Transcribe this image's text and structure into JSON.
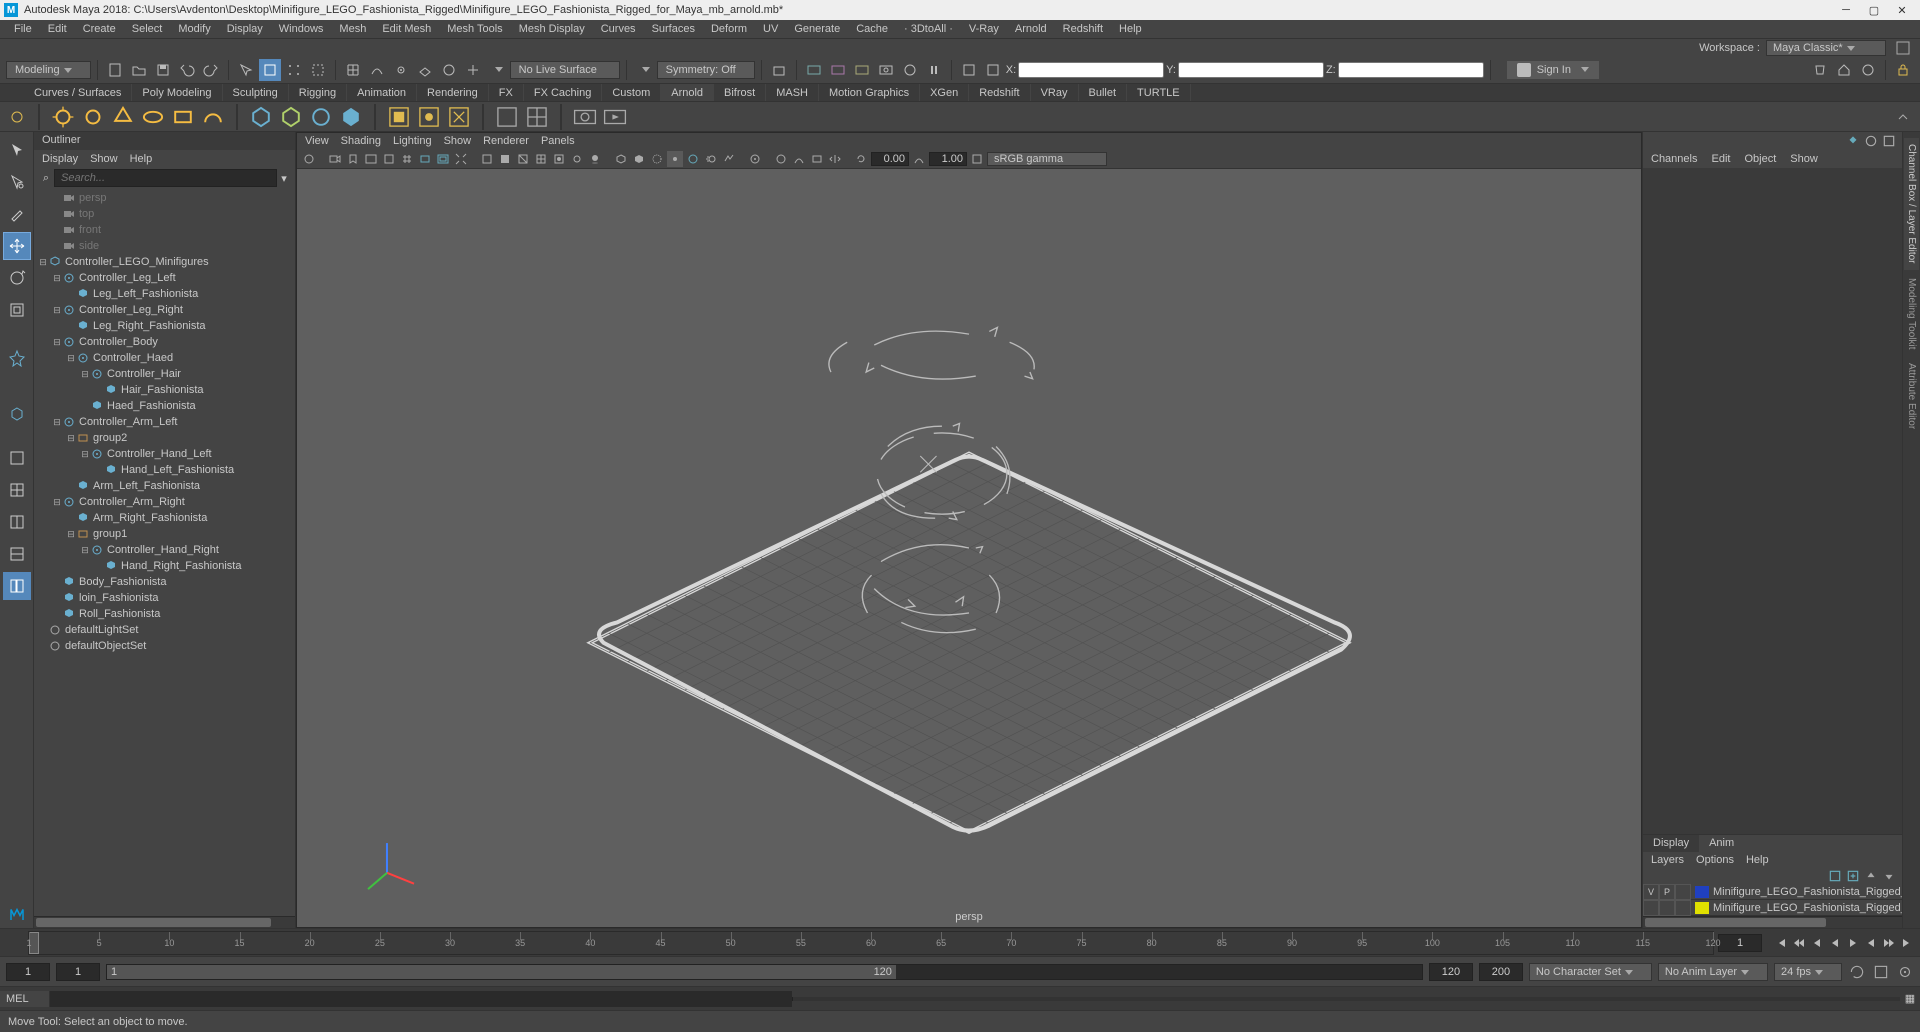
{
  "title": "Autodesk Maya 2018: C:\\Users\\Avdenton\\Desktop\\Minifigure_LEGO_Fashionista_Rigged\\Minifigure_LEGO_Fashionista_Rigged_for_Maya_mb_arnold.mb*",
  "menu": [
    "File",
    "Edit",
    "Create",
    "Select",
    "Modify",
    "Display",
    "Windows",
    "Mesh",
    "Edit Mesh",
    "Mesh Tools",
    "Mesh Display",
    "Curves",
    "Surfaces",
    "Deform",
    "UV",
    "Generate",
    "Cache",
    "· 3DtoAll ·",
    "V-Ray",
    "Arnold",
    "Redshift",
    "Help"
  ],
  "workspace": {
    "label": "Workspace :",
    "value": "Maya Classic*"
  },
  "statusline": {
    "mode": "Modeling",
    "liveSurface": "No Live Surface",
    "symmetry": "Symmetry: Off",
    "x": "X:",
    "y": "Y:",
    "z": "Z:",
    "signin": "Sign In"
  },
  "shelfTabs": [
    "Curves / Surfaces",
    "Poly Modeling",
    "Sculpting",
    "Rigging",
    "Animation",
    "Rendering",
    "FX",
    "FX Caching",
    "Custom",
    "Arnold",
    "Bifrost",
    "MASH",
    "Motion Graphics",
    "XGen",
    "Redshift",
    "VRay",
    "Bullet",
    "TURTLE"
  ],
  "shelfActive": "Arnold",
  "outliner": {
    "title": "Outliner",
    "menu": [
      "Display",
      "Show",
      "Help"
    ],
    "search": "Search...",
    "cams": [
      "persp",
      "top",
      "front",
      "side"
    ],
    "tree": [
      {
        "d": 0,
        "exp": "▾",
        "ico": "grp",
        "name": "Controller_LEGO_Minifigures"
      },
      {
        "d": 1,
        "exp": "▾",
        "ico": "ctrl",
        "name": "Controller_Leg_Left"
      },
      {
        "d": 2,
        "exp": "",
        "ico": "mesh",
        "name": "Leg_Left_Fashionista"
      },
      {
        "d": 1,
        "exp": "▾",
        "ico": "ctrl",
        "name": "Controller_Leg_Right"
      },
      {
        "d": 2,
        "exp": "",
        "ico": "mesh",
        "name": "Leg_Right_Fashionista"
      },
      {
        "d": 1,
        "exp": "▾",
        "ico": "ctrl",
        "name": "Controller_Body"
      },
      {
        "d": 2,
        "exp": "▾",
        "ico": "ctrl",
        "name": "Controller_Haed"
      },
      {
        "d": 3,
        "exp": "▾",
        "ico": "ctrl",
        "name": "Controller_Hair"
      },
      {
        "d": 4,
        "exp": "",
        "ico": "mesh",
        "name": "Hair_Fashionista"
      },
      {
        "d": 3,
        "exp": "",
        "ico": "mesh",
        "name": "Haed_Fashionista"
      },
      {
        "d": 1,
        "exp": "▾",
        "ico": "ctrl",
        "name": "Controller_Arm_Left"
      },
      {
        "d": 2,
        "exp": "▾",
        "ico": "grp2",
        "name": "group2"
      },
      {
        "d": 3,
        "exp": "▾",
        "ico": "ctrl",
        "name": "Controller_Hand_Left"
      },
      {
        "d": 4,
        "exp": "",
        "ico": "mesh",
        "name": "Hand_Left_Fashionista"
      },
      {
        "d": 2,
        "exp": "",
        "ico": "mesh",
        "name": "Arm_Left_Fashionista"
      },
      {
        "d": 1,
        "exp": "▾",
        "ico": "ctrl",
        "name": "Controller_Arm_Right"
      },
      {
        "d": 2,
        "exp": "",
        "ico": "mesh",
        "name": "Arm_Right_Fashionista"
      },
      {
        "d": 2,
        "exp": "▾",
        "ico": "grp2",
        "name": "group1"
      },
      {
        "d": 3,
        "exp": "▾",
        "ico": "ctrl",
        "name": "Controller_Hand_Right"
      },
      {
        "d": 4,
        "exp": "",
        "ico": "mesh",
        "name": "Hand_Right_Fashionista"
      },
      {
        "d": 1,
        "exp": "",
        "ico": "mesh",
        "name": "Body_Fashionista"
      },
      {
        "d": 1,
        "exp": "",
        "ico": "mesh",
        "name": "loin_Fashionista"
      },
      {
        "d": 1,
        "exp": "",
        "ico": "mesh",
        "name": "Roll_Fashionista"
      },
      {
        "d": 0,
        "exp": "",
        "ico": "set",
        "name": "defaultLightSet"
      },
      {
        "d": 0,
        "exp": "",
        "ico": "set",
        "name": "defaultObjectSet"
      }
    ]
  },
  "viewport": {
    "menu": [
      "View",
      "Shading",
      "Lighting",
      "Show",
      "Renderer",
      "Panels"
    ],
    "val1": "0.00",
    "val2": "1.00",
    "renderer": "sRGB gamma",
    "camLabel": "persp"
  },
  "channelBox": {
    "tabs": [
      "Channels",
      "Edit",
      "Object",
      "Show"
    ]
  },
  "layerPanel": {
    "tabs": [
      "Display",
      "Anim"
    ],
    "menu": [
      "Layers",
      "Options",
      "Help"
    ],
    "rows": [
      {
        "v": "V",
        "p": "P",
        "col": "#2040c0",
        "name": "Minifigure_LEGO_Fashionista_Rigged_Contro"
      },
      {
        "v": "",
        "p": "",
        "col": "#e0e000",
        "name": "Minifigure_LEGO_Fashionista_Rigged_Geome"
      }
    ]
  },
  "sideTabs": [
    "Channel Box / Layer Editor",
    "Modeling Toolkit",
    "Attribute Editor"
  ],
  "timeline": {
    "start": "1",
    "end": "200",
    "rangeStart": "1",
    "rangeEnd": "120",
    "rangeStart2": "120",
    "rangeEnd2": "200",
    "curFrame": "1",
    "charset": "No Character Set",
    "animlayer": "No Anim Layer",
    "fps": "24 fps",
    "ticks": [
      1,
      5,
      10,
      15,
      20,
      25,
      30,
      35,
      40,
      45,
      50,
      55,
      60,
      65,
      70,
      75,
      80,
      85,
      90,
      95,
      100,
      105,
      110,
      115,
      120
    ]
  },
  "cmdline": {
    "lang": "MEL"
  },
  "helpline": "Move Tool: Select an object to move."
}
